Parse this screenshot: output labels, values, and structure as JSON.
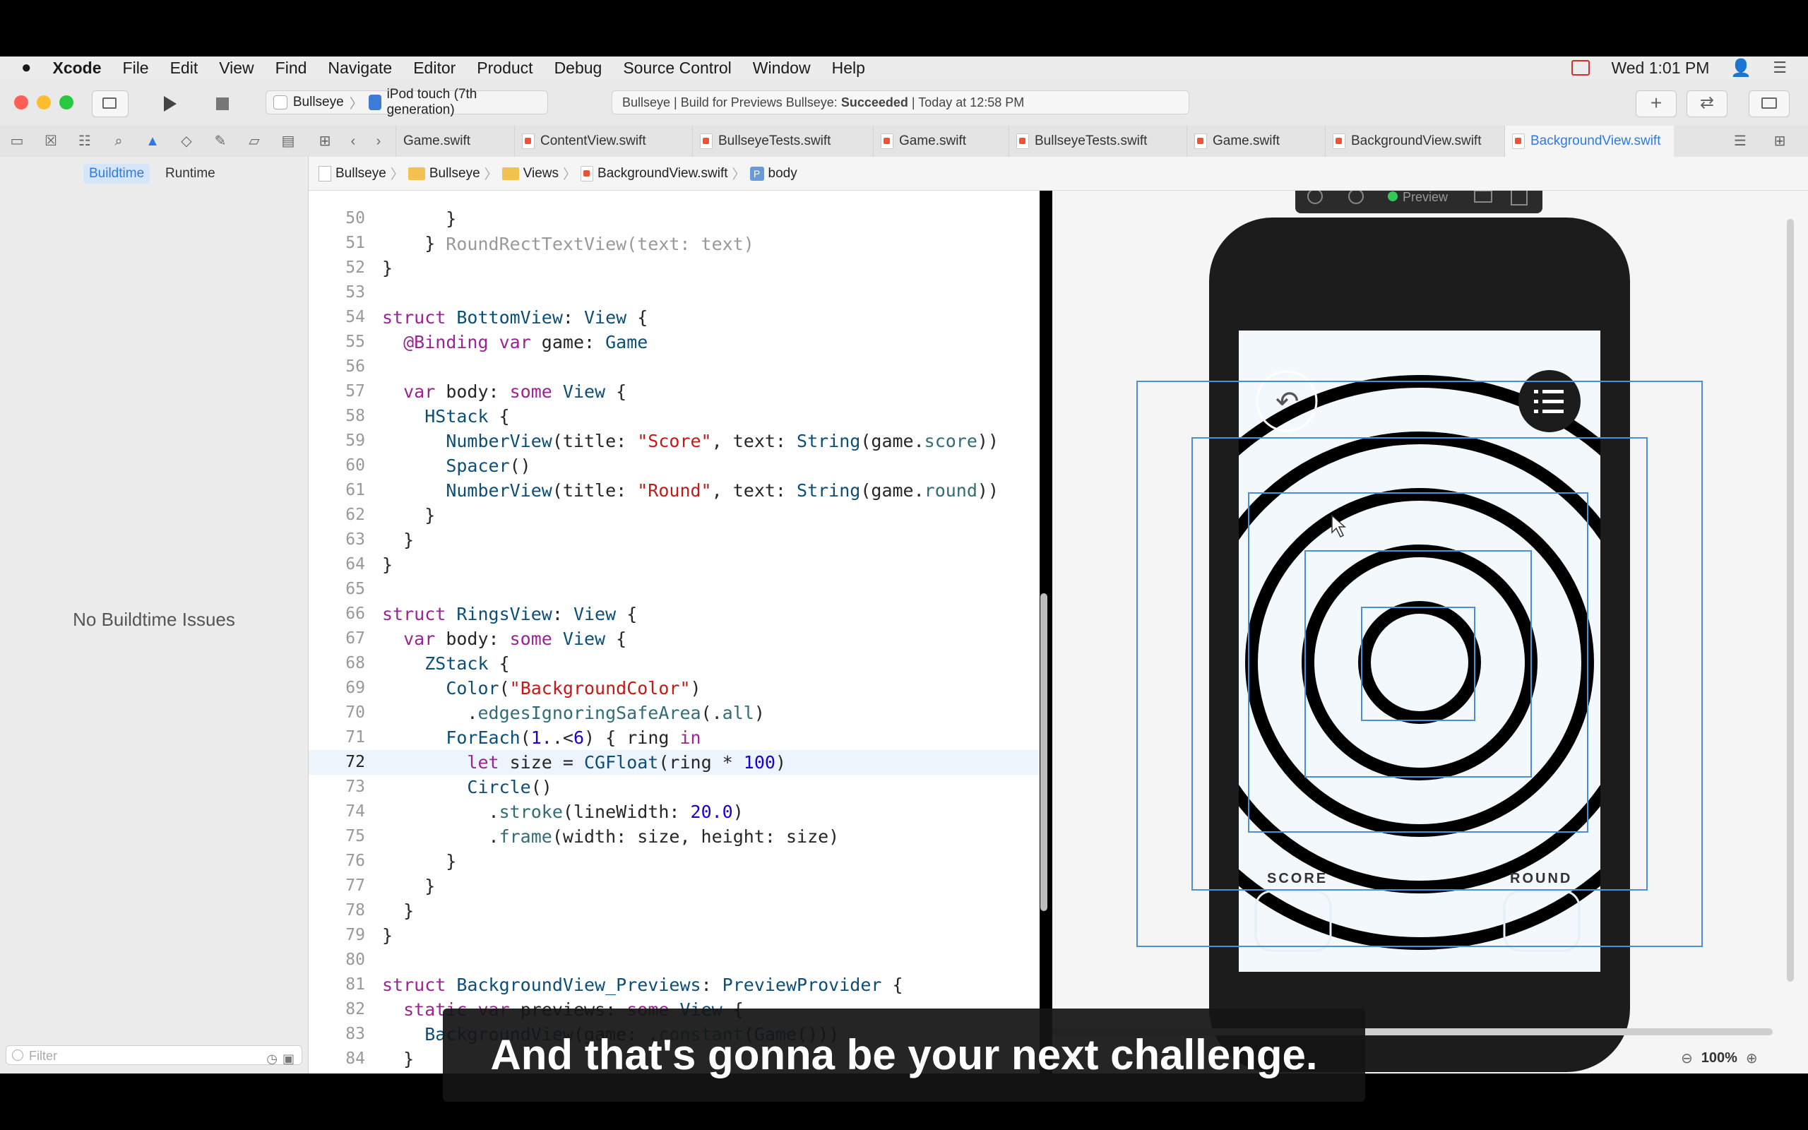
{
  "menubar": {
    "items": [
      "Xcode",
      "File",
      "Edit",
      "View",
      "Find",
      "Navigate",
      "Editor",
      "Product",
      "Debug",
      "Source Control",
      "Window",
      "Help"
    ],
    "clock": "Wed 1:01 PM"
  },
  "toolbar": {
    "scheme": "Bullseye",
    "device": "iPod touch (7th generation)",
    "activity_prefix": "Bullseye | Build for Previews Bullseye: ",
    "activity_status": "Succeeded",
    "activity_time": " | Today at 12:58 PM"
  },
  "tabs": [
    "Game.swift",
    "ContentView.swift",
    "BullseyeTests.swift",
    "Game.swift",
    "BullseyeTests.swift",
    "Game.swift",
    "BackgroundView.swift",
    "BackgroundView.swift"
  ],
  "left_panel": {
    "segment_buildtime": "Buildtime",
    "segment_runtime": "Runtime",
    "empty_message": "No Buildtime Issues",
    "filter_placeholder": "Filter"
  },
  "breadcrumb": [
    "Bullseye",
    "Bullseye",
    "Views",
    "BackgroundView.swift",
    "body"
  ],
  "code": {
    "current_line": 72,
    "lines": [
      {
        "n": 50,
        "t": "      }"
      },
      {
        "n": 51,
        "t": "    }"
      },
      {
        "n": 52,
        "t": "}"
      },
      {
        "n": 53,
        "t": ""
      },
      {
        "n": 54,
        "t": "struct BottomView: View {"
      },
      {
        "n": 55,
        "t": "  @Binding var game: Game"
      },
      {
        "n": 56,
        "t": ""
      },
      {
        "n": 57,
        "t": "  var body: some View {"
      },
      {
        "n": 58,
        "t": "    HStack {"
      },
      {
        "n": 59,
        "t": "      NumberView(title: \"Score\", text: String(game.score))"
      },
      {
        "n": 60,
        "t": "      Spacer()"
      },
      {
        "n": 61,
        "t": "      NumberView(title: \"Round\", text: String(game.round))"
      },
      {
        "n": 62,
        "t": "    }"
      },
      {
        "n": 63,
        "t": "  }"
      },
      {
        "n": 64,
        "t": "}"
      },
      {
        "n": 65,
        "t": ""
      },
      {
        "n": 66,
        "t": "struct RingsView: View {"
      },
      {
        "n": 67,
        "t": "  var body: some View {"
      },
      {
        "n": 68,
        "t": "    ZStack {"
      },
      {
        "n": 69,
        "t": "      Color(\"BackgroundColor\")"
      },
      {
        "n": 70,
        "t": "        .edgesIgnoringSafeArea(.all)"
      },
      {
        "n": 71,
        "t": "      ForEach(1..<6) { ring in"
      },
      {
        "n": 72,
        "t": "        let size = CGFloat(ring * 100)"
      },
      {
        "n": 73,
        "t": "        Circle()"
      },
      {
        "n": 74,
        "t": "          .stroke(lineWidth: 20.0)"
      },
      {
        "n": 75,
        "t": "          .frame(width: size, height: size)"
      },
      {
        "n": 76,
        "t": "      }"
      },
      {
        "n": 77,
        "t": "    }"
      },
      {
        "n": 78,
        "t": "  }"
      },
      {
        "n": 79,
        "t": "}"
      },
      {
        "n": 80,
        "t": ""
      },
      {
        "n": 81,
        "t": "struct BackgroundView_Previews: PreviewProvider {"
      },
      {
        "n": 82,
        "t": "  static var previews: some View {"
      },
      {
        "n": 83,
        "t": "    BackgroundView(game: .constant(Game()))"
      },
      {
        "n": 84,
        "t": "  }"
      }
    ]
  },
  "preview": {
    "status_label": "Preview",
    "score_label": "SCORE",
    "round_label": "ROUND",
    "zoom": "100%"
  },
  "subtitle": "And that's gonna be your next challenge.",
  "colors": {
    "accent": "#2c7be5",
    "ring": "#000000",
    "ring_background": "#f3f8fd",
    "device_frame": "#1c1c1c",
    "selection_outline": "#4a90d9",
    "traffic_red": "#fe5f57",
    "traffic_yellow": "#febc2e",
    "traffic_green": "#28c840"
  }
}
